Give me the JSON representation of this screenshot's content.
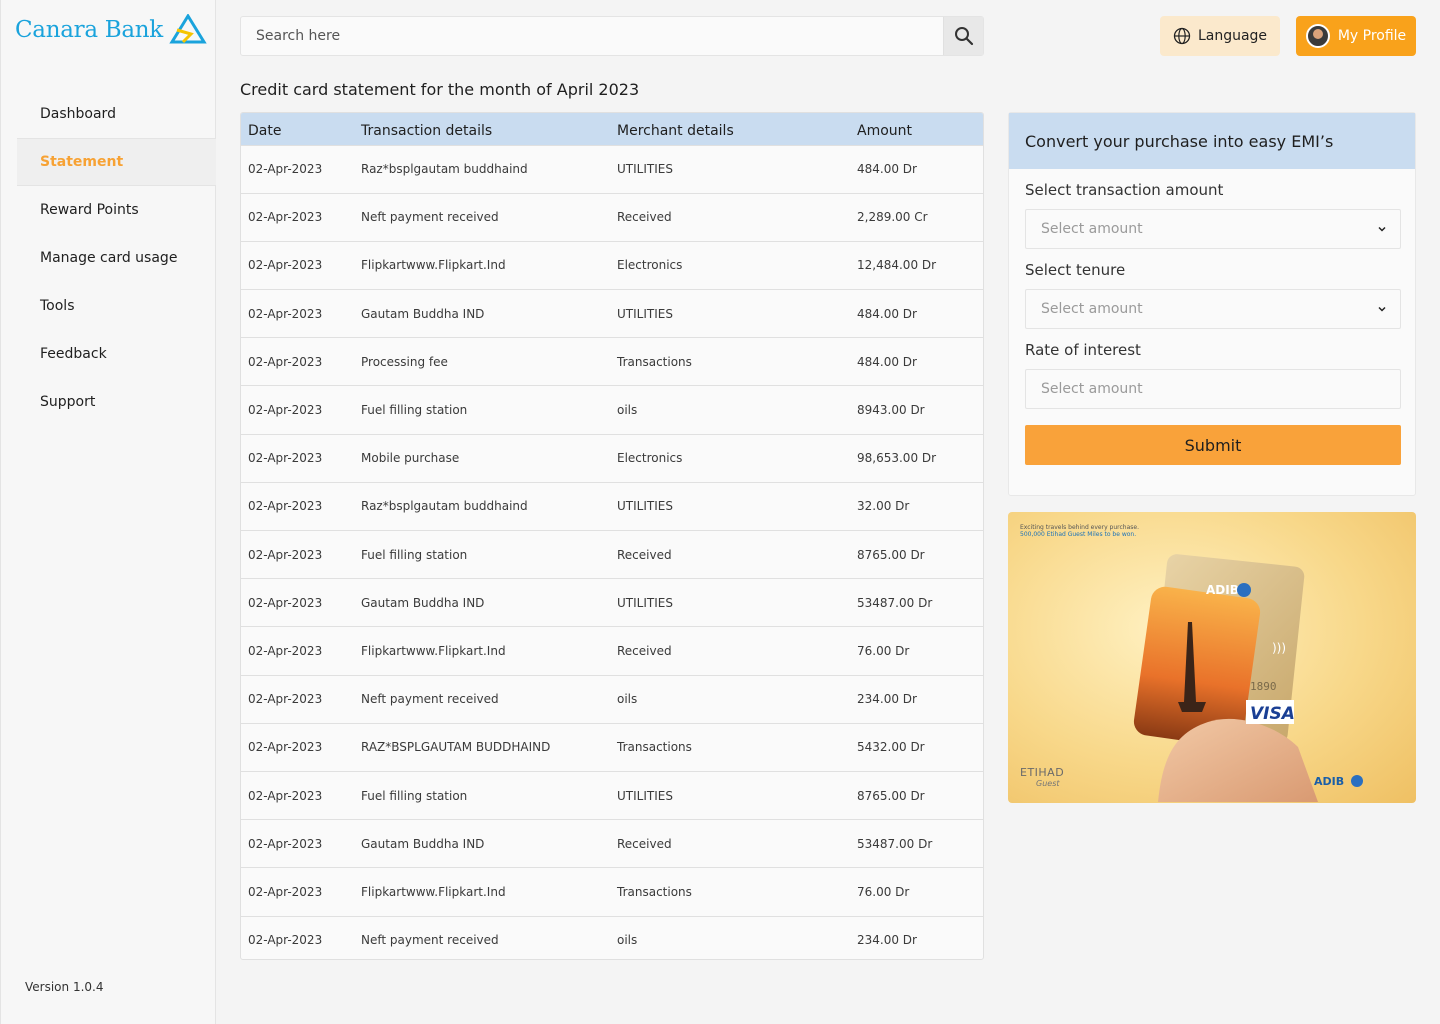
{
  "brand": {
    "name": "Canara Bank"
  },
  "sidebar": {
    "items": [
      {
        "label": "Dashboard",
        "active": false
      },
      {
        "label": "Statement",
        "active": true
      },
      {
        "label": "Reward Points",
        "active": false
      },
      {
        "label": "Manage card usage",
        "active": false
      },
      {
        "label": "Tools",
        "active": false
      },
      {
        "label": "Feedback",
        "active": false
      },
      {
        "label": "Support",
        "active": false
      }
    ],
    "version": "Version 1.0.4"
  },
  "header": {
    "search_placeholder": "Search here",
    "language_label": "Language",
    "profile_label": "My Profile"
  },
  "statement": {
    "title": "Credit card statement for the month of April 2023",
    "columns": [
      "Date",
      "Transaction details",
      "Merchant details",
      "Amount"
    ],
    "rows": [
      [
        "02-Apr-2023",
        "Raz*bsplgautam buddhaind",
        "UTILITIES",
        "484.00 Dr"
      ],
      [
        "02-Apr-2023",
        "Neft payment received",
        "Received",
        "2,289.00 Cr"
      ],
      [
        "02-Apr-2023",
        "Flipkartwww.Flipkart.Ind",
        "Electronics",
        "12,484.00 Dr"
      ],
      [
        "02-Apr-2023",
        "Gautam Buddha IND",
        "UTILITIES",
        "484.00 Dr"
      ],
      [
        "02-Apr-2023",
        "Processing fee",
        "Transactions",
        "484.00 Dr"
      ],
      [
        "02-Apr-2023",
        "Fuel filling station",
        "oils",
        "8943.00 Dr"
      ],
      [
        "02-Apr-2023",
        "Mobile purchase",
        "Electronics",
        "98,653.00 Dr"
      ],
      [
        "02-Apr-2023",
        "Raz*bsplgautam buddhaind",
        "UTILITIES",
        "32.00 Dr"
      ],
      [
        "02-Apr-2023",
        "Fuel filling station",
        "Received",
        "8765.00 Dr"
      ],
      [
        "02-Apr-2023",
        "Gautam Buddha IND",
        "UTILITIES",
        "53487.00 Dr"
      ],
      [
        "02-Apr-2023",
        "Flipkartwww.Flipkart.Ind",
        "Received",
        "76.00 Dr"
      ],
      [
        "02-Apr-2023",
        "Neft payment received",
        "oils",
        "234.00 Dr"
      ],
      [
        "02-Apr-2023",
        "RAZ*BSPLGAUTAM BUDDHAIND",
        "Transactions",
        "5432.00 Dr"
      ],
      [
        "02-Apr-2023",
        "Fuel filling station",
        "UTILITIES",
        "8765.00 Dr"
      ],
      [
        "02-Apr-2023",
        "Gautam Buddha IND",
        "Received",
        "53487.00 Dr"
      ],
      [
        "02-Apr-2023",
        "Flipkartwww.Flipkart.Ind",
        "Transactions",
        "76.00 Dr"
      ],
      [
        "02-Apr-2023",
        "Neft payment received",
        "oils",
        "234.00 Dr"
      ]
    ]
  },
  "emi": {
    "title": "Convert your purchase into easy EMI’s",
    "amount_label": "Select transaction amount",
    "amount_placeholder": "Select amount",
    "tenure_label": "Select tenure",
    "tenure_placeholder": "Select amount",
    "rate_label": "Rate of interest",
    "rate_placeholder": "Select amount",
    "submit_label": "Submit"
  },
  "promo": {
    "tagline_1": "Exciting travels behind every purchase.",
    "tagline_2": "500,000 Etihad Guest Miles to be won.",
    "card_issuer": "ADIB",
    "card_network": "VISA",
    "card_number_fragment": "1890",
    "partner": "ETIHAD",
    "partner_sub": "Guest",
    "footer_brand": "ADIB"
  },
  "colors": {
    "accent": "#f9a21b",
    "table_header": "#c9dcf0",
    "brand_blue": "#1aa3dc"
  }
}
